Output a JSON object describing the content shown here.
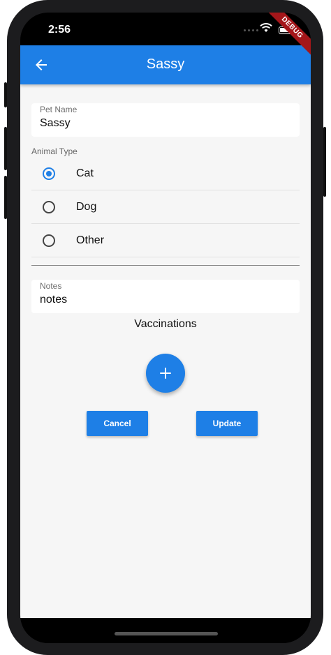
{
  "status_bar": {
    "time": "2:56"
  },
  "debug_banner": "DEBUG",
  "app_bar": {
    "title": "Sassy"
  },
  "form": {
    "pet_name": {
      "label": "Pet Name",
      "value": "Sassy"
    },
    "animal_type": {
      "label": "Animal Type",
      "options": [
        {
          "label": "Cat",
          "selected": true
        },
        {
          "label": "Dog",
          "selected": false
        },
        {
          "label": "Other",
          "selected": false
        }
      ]
    },
    "notes": {
      "label": "Notes",
      "value": "notes"
    },
    "vaccinations_title": "Vaccinations"
  },
  "buttons": {
    "cancel": "Cancel",
    "update": "Update"
  },
  "icons": {
    "back": "arrow-left-icon",
    "add": "plus-icon",
    "wifi": "wifi-icon",
    "battery": "battery-icon"
  },
  "colors": {
    "primary": "#1e7fe6",
    "background": "#f6f6f6"
  }
}
